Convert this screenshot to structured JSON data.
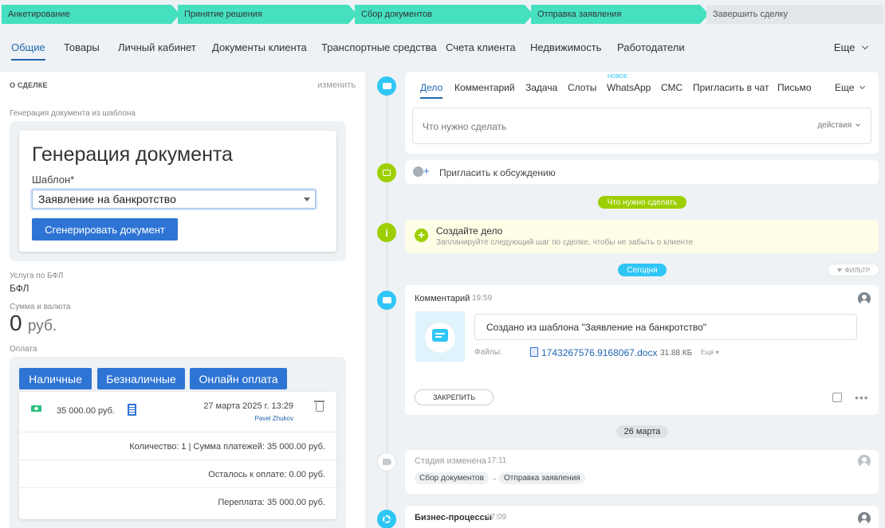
{
  "stages": [
    {
      "label": "Анкетирование"
    },
    {
      "label": "Принятие решения"
    },
    {
      "label": "Сбор документов"
    },
    {
      "label": "Отправка заявления"
    },
    {
      "label": "Завершить сделку"
    }
  ],
  "tabs": {
    "items": [
      "Общие",
      "Товары",
      "Личный кабинет",
      "Документы клиента",
      "Транспортные средства",
      "Счета клиента",
      "Недвижимость",
      "Работодатели"
    ],
    "more": "Еще"
  },
  "left": {
    "section_title": "О СДЕЛКЕ",
    "change_link": "изменить",
    "gen_label": "Генерация документа из шаблона",
    "gen_title": "Генерация документа",
    "template_label": "Шаблон*",
    "template_value": "Заявление на банкротство",
    "generate_button": "Сгенерировать документ",
    "service_label": "Услуга по БФЛ",
    "service_value": "БФЛ",
    "sum_label": "Сумма и валюта",
    "sum_value": "0",
    "sum_currency": "руб.",
    "payment_label": "Оплата",
    "pay_buttons": [
      "Наличные",
      "Безналичные",
      "Онлайн оплата"
    ],
    "payment": {
      "amount": "35 000.00 руб.",
      "date": "27 марта 2025 г. 13:29",
      "user": "Pavel Zhukov",
      "count_sum": "Количество: 1 | Сумма платежей: 35 000.00 руб.",
      "remaining": "Осталось к оплате: 0.00 руб.",
      "overpay": "Переплата: 35 000.00 руб."
    }
  },
  "right": {
    "composer": {
      "tabs": [
        "Дело",
        "Комментарий",
        "Задача",
        "Слоты",
        "WhatsApp",
        "СМС",
        "Пригласить в чат",
        "Письмо"
      ],
      "new_badge": "НОВОЕ",
      "more": "Еще",
      "placeholder": "Что нужно сделать",
      "actions": "действия"
    },
    "invite_text": "Пригласить к обсуждению",
    "todo_pill": "Что нужно сделать",
    "create_case": {
      "title": "Создайте дело",
      "subtitle": "Запланируйте следующий шаг по сделке, чтобы не забыть о клиенте"
    },
    "today_pill": "Сегодня",
    "filter": "ФИЛЬТР",
    "comment": {
      "title": "Комментарий",
      "time": "19:59",
      "text": "Создано из шаблона \"Заявление на банкротство\"",
      "files_label": "Файлы:",
      "file_name": "1743267576.9168067.docx",
      "file_size": "31.88 КБ",
      "file_more": "Ещё",
      "pin_button": "ЗАКРЕПИТЬ"
    },
    "date_pill": "26 марта",
    "stage_change": {
      "title": "Стадия изменена",
      "time": "17:11",
      "from": "Сбор документов",
      "to": "Отправка заявления"
    },
    "bp": {
      "title": "Бизнес-процессы",
      "time": "17:09"
    }
  },
  "colors": {
    "stage_active": "#45e0c0",
    "accent_blue": "#2e74d4",
    "timeline_blue": "#2fc6f6",
    "timeline_green": "#9dcf00"
  }
}
